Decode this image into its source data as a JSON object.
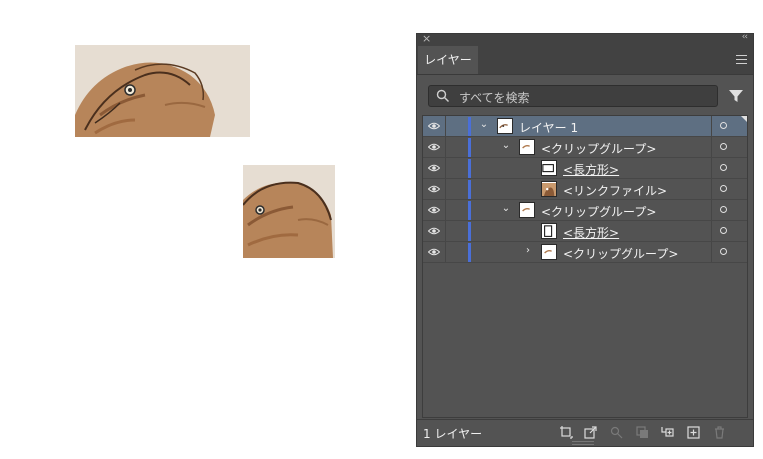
{
  "panel": {
    "close_glyph": "×",
    "collapse_glyph": "‹‹",
    "tab_label": "レイヤー",
    "menu_icon": "hamburger-menu-icon",
    "search_placeholder": "すべてを検索",
    "search_icon": "search-icon",
    "filter_icon": "filter-icon",
    "footer_count": "1 レイヤー",
    "accent_color": "#4a6fd8",
    "selected_row_color": "#5e6f82"
  },
  "layers": [
    {
      "label": "レイヤー 1",
      "chevron": "⌄",
      "expanded": true,
      "thumb": "layer"
    },
    {
      "label": "<クリップグループ>",
      "chevron": "⌄",
      "expanded": true,
      "thumb": "clip"
    },
    {
      "label": "<長方形>",
      "chevron": "",
      "thumb": "rect-wide",
      "underlined": true
    },
    {
      "label": "<リンクファイル>",
      "chevron": "",
      "thumb": "image"
    },
    {
      "label": "<クリップグループ>",
      "chevron": "⌄",
      "expanded": true,
      "thumb": "clip"
    },
    {
      "label": "<長方形>",
      "chevron": "",
      "thumb": "rect-tall",
      "underlined": true
    },
    {
      "label": "<クリップグループ>",
      "chevron": "›",
      "expanded": false,
      "thumb": "clip"
    }
  ],
  "footer_icons": [
    "collect-for-export-icon",
    "export-icon",
    "locate-object-icon",
    "make-clipping-mask-icon",
    "create-sublayer-icon",
    "new-layer-icon",
    "delete-icon"
  ]
}
